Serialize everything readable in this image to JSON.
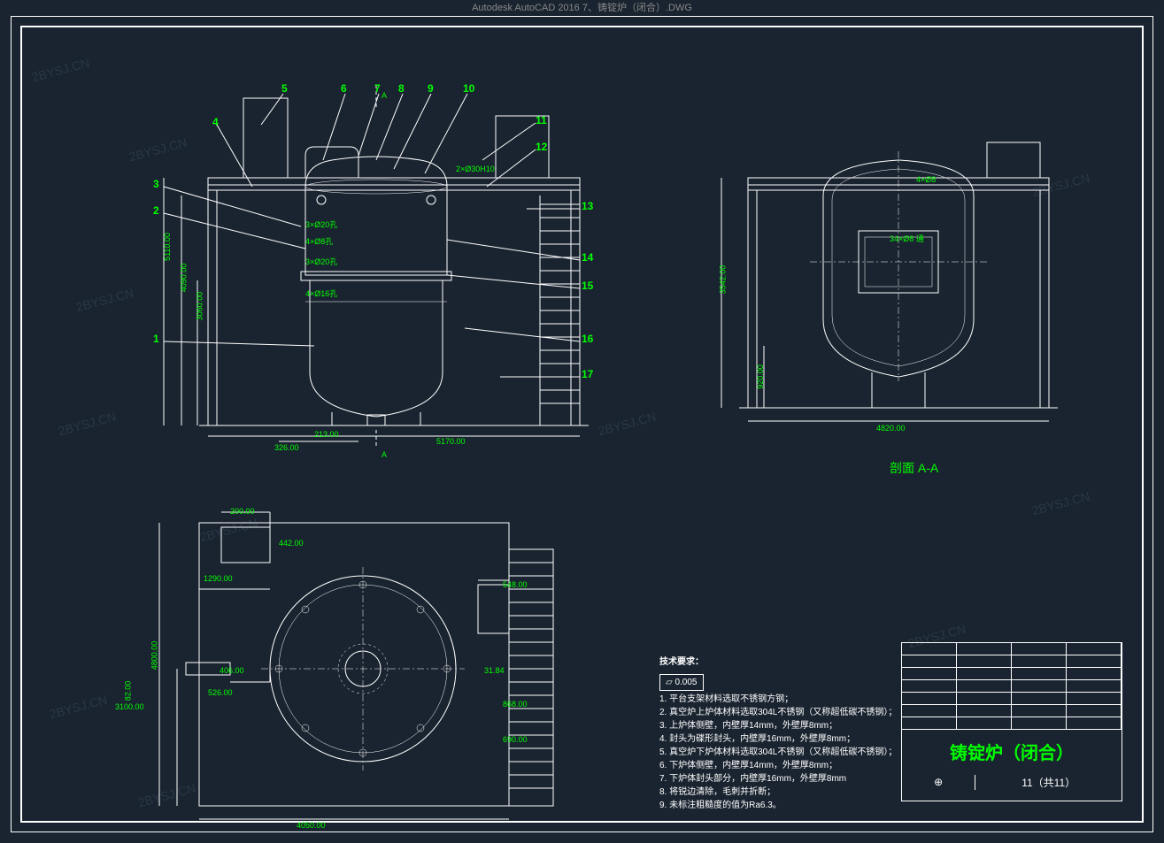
{
  "app_title": "Autodesk AutoCAD 2016   7、铸锭炉（闭合）.DWG",
  "watermark_text": "2BYSJ.CN",
  "front_view": {
    "callouts": [
      "1",
      "2",
      "3",
      "4",
      "5",
      "6",
      "7",
      "8",
      "9",
      "10",
      "11",
      "12",
      "13",
      "14",
      "15",
      "16",
      "17"
    ],
    "section_marks": {
      "top": "A",
      "bottom": "A"
    },
    "dims": {
      "h1": "5110.00",
      "h2": "4090.00",
      "h3": "3060.00",
      "w_bottom": "5170.00",
      "w1": "326.00",
      "w2": "213.00",
      "hole1": "2×Ø30H10",
      "hole2": "3×Ø20孔",
      "hole3": "4×Ø8孔",
      "hole4": "3×Ø20孔",
      "hole5": "4×Ø16孔"
    }
  },
  "section_view": {
    "label": "剖面 A-A",
    "dims": {
      "h1": "3542.00",
      "h2": "920.00",
      "w": "4820.00",
      "hole1": "4×Ø8",
      "hole2": "34×Ø8 通"
    }
  },
  "top_view": {
    "dims": {
      "h1": "4800.00",
      "h2": "3100.00",
      "h3": "82.00",
      "w": "4050.00",
      "d1": "200.00",
      "d2": "442.00",
      "d3": "1290.00",
      "d4": "548.00",
      "d5": "406.00",
      "d6": "526.00",
      "d7": "31.84",
      "d8": "868.00",
      "d9": "690.00"
    }
  },
  "tech_req": {
    "header": "技术要求：",
    "tolerance": "⏥ 0.005",
    "items": [
      "1. 平台支架材料选取不锈钢方钢；",
      "2. 真空炉上炉体材料选取304L不锈钢（又称超低碳不锈钢）；",
      "3. 上炉体侧壁，内壁厚14mm，外壁厚8mm；",
      "4. 封头为碟形封头，内壁厚16mm，外壁厚8mm；",
      "5. 真空炉下炉体材料选取304L不锈钢（又称超低碳不锈钢）；",
      "6. 下炉体侧壁，内壁厚14mm，外壁厚8mm；",
      "7. 下炉体封头部分，内壁厚16mm，外壁厚8mm",
      "8. 将锐边清除，毛刺并折断；",
      "9. 未标注粗糙度的值为Ra6.3。"
    ]
  },
  "title_block": {
    "title": "铸锭炉（闭合）",
    "sheet": "11（共11）",
    "scale": "",
    "marker": "⊕"
  }
}
